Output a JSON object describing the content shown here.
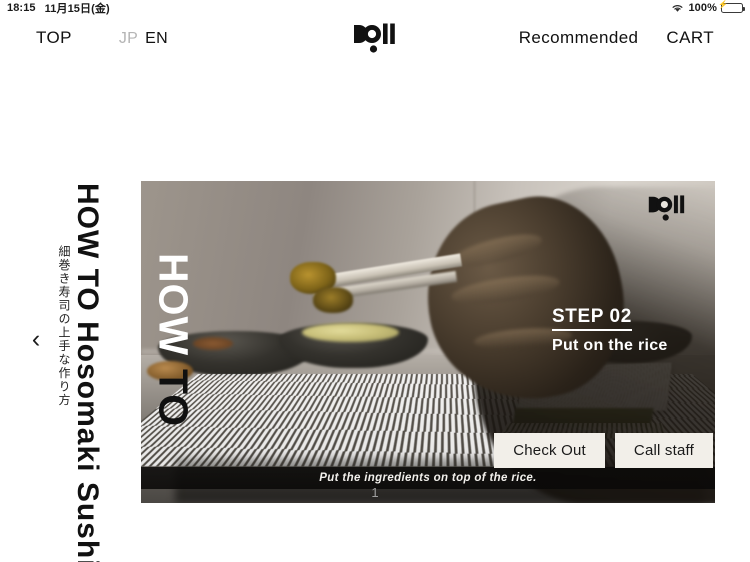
{
  "statusbar": {
    "time": "18:15",
    "date": "11月15日(金)",
    "wifi_icon": "wifi-icon",
    "battery_percent": "100%",
    "battery_icon": "battery-charging-icon",
    "battery_color": "#4cd763"
  },
  "navbar": {
    "top_label": "TOP",
    "lang_jp": "JP",
    "lang_en": "EN",
    "logo_alt": "doi-logo",
    "recommended_label": "Recommended",
    "cart_label": "CART"
  },
  "main": {
    "prev_arrow": "‹",
    "title_main": "HOW TO Hosomaki Sushi",
    "title_sub": "細巻き寿司の上手な作り方",
    "video": {
      "watermark_how": "HOW",
      "watermark_to": "TO",
      "logo_alt": "doi-logo-watermark",
      "step_number": "STEP 02",
      "step_description": "Put on the rice",
      "subtitle": "Put the ingredients on top of the rice."
    },
    "checkout_label": "Check Out",
    "callstaff_label": "Call staff",
    "page_number": "1"
  }
}
